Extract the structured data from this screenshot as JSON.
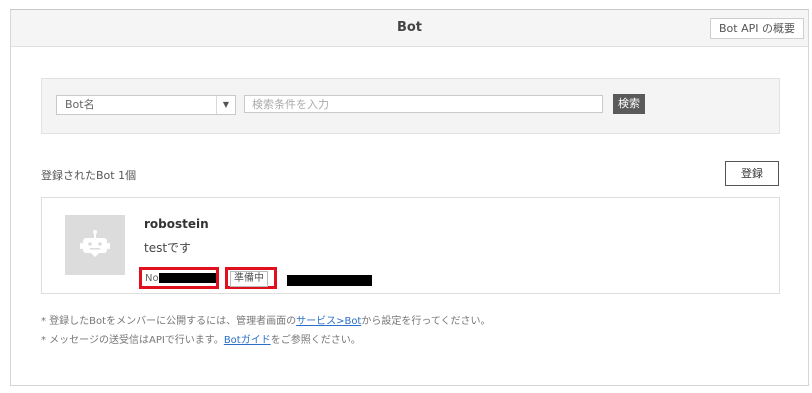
{
  "header": {
    "title": "Bot",
    "api_button": "Bot API の概要"
  },
  "search": {
    "select_value": "Bot名",
    "input_placeholder": "検索条件を入力",
    "button": "検索"
  },
  "list": {
    "count_label": "登録されたBot 1個",
    "register_button": "登録"
  },
  "bot": {
    "name": "robostein",
    "description": "testです",
    "no_prefix": "No.",
    "status": "準備中"
  },
  "notes": {
    "line1_pre": "* 登録したBotをメンバーに公開するには、管理者画面の",
    "line1_link": "サービス>Bot",
    "line1_post": "から設定を行ってください。",
    "line2_pre": "* メッセージの送受信はAPIで行います。",
    "line2_link": "Botガイド",
    "line2_post": "をご参照ください。"
  },
  "colors": {
    "highlight_border": "#e0101e",
    "link": "#2a6fc9"
  }
}
